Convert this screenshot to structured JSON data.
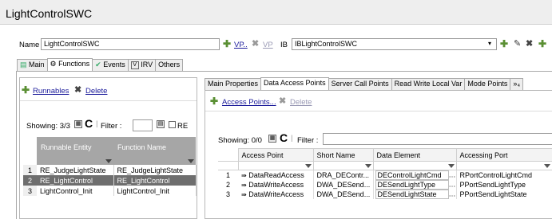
{
  "window": {
    "title": "LightControlSWC"
  },
  "header": {
    "name_label": "Name",
    "name_value": "LightControlSWC",
    "vp_label": "VP..",
    "vp2_label": "VP",
    "ib_label": "IB",
    "ib_value": "IBLightControlSWC"
  },
  "left_tabs": [
    {
      "label": "Main"
    },
    {
      "label": "Functions"
    },
    {
      "label": "Events"
    },
    {
      "label": "IRV"
    },
    {
      "label": "Others"
    }
  ],
  "functions": {
    "runnables_link": "Runnables",
    "delete_link": "Delete",
    "showing": "Showing: 3/3",
    "filter_label": "Filter :",
    "filter_value": "",
    "re_label": "RE",
    "columns": [
      "Runnable Entity",
      "Function Name"
    ],
    "rows": [
      {
        "num": "1",
        "entity": "RE_JudgeLightState",
        "function": "RE_JudgeLightState"
      },
      {
        "num": "2",
        "entity": "RE_LightControl",
        "function": "RE_LightControl"
      },
      {
        "num": "3",
        "entity": "LightControl_Init",
        "function": "LightControl_Init"
      }
    ]
  },
  "right_tabs": [
    {
      "label": "Main Properties"
    },
    {
      "label": "Data Access Points"
    },
    {
      "label": "Server Call Points"
    },
    {
      "label": "Read Write Local Var"
    },
    {
      "label": "Mode Points"
    },
    {
      "label": "»₄"
    }
  ],
  "access_points": {
    "access_link": "Access Points...",
    "delete_link": "Delete",
    "showing": "Showing: 0/0",
    "filter_label": "Filter :",
    "filter_value": "",
    "columns": [
      "Access Point",
      "Short Name",
      "Data Element",
      "Accessing Port"
    ],
    "rows": [
      {
        "num": "1",
        "access": "DataReadAccess",
        "short": "DRA_DEContr...",
        "element": "DEControlLightCmd",
        "port": "RPortControlLightCmd"
      },
      {
        "num": "2",
        "access": "DataWriteAccess",
        "short": "DWA_DESend...",
        "element": "DESendLightType",
        "port": "PPortSendLightType"
      },
      {
        "num": "3",
        "access": "DataWriteAccess",
        "short": "DWA_DESend...",
        "element": "DESendLightState",
        "port": "PPortSendLightState"
      }
    ]
  },
  "colors": {
    "accent_green": "#5a8f33",
    "selected_row": "#6e6e6e",
    "header_grey": "#a6a6a6"
  }
}
